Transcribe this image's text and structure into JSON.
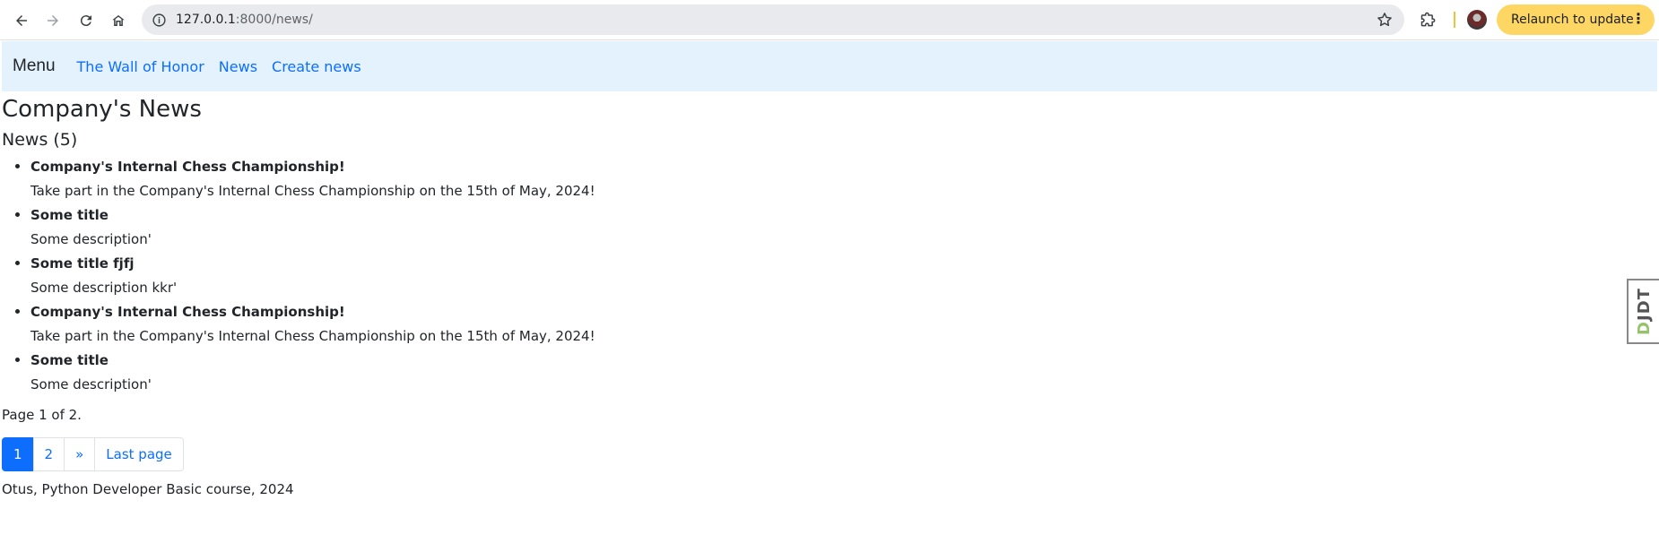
{
  "browser": {
    "url_host": "127.0.0.1",
    "url_rest": ":8000/news/",
    "relaunch_label": "Relaunch to update",
    "relaunch_menu": "⋮"
  },
  "navbar": {
    "brand": "Menu",
    "links": [
      "The Wall of Honor",
      "News",
      "Create news"
    ]
  },
  "page": {
    "title": "Company's News",
    "news_heading": "News (5)",
    "items": [
      {
        "title": "Company's Internal Chess Championship!",
        "description": "Take part in the Company's Internal Chess Championship on the 15th of May, 2024!"
      },
      {
        "title": "Some title",
        "description": "Some description'"
      },
      {
        "title": "Some title fjfj",
        "description": "Some description kkr'"
      },
      {
        "title": "Company's Internal Chess Championship!",
        "description": "Take part in the Company's Internal Chess Championship on the 15th of May, 2024!"
      },
      {
        "title": "Some title",
        "description": "Some description'"
      }
    ],
    "page_info": "Page 1 of 2.",
    "pagination": {
      "current": "1",
      "next_page": "2",
      "next": "»",
      "last": "Last page"
    },
    "footer": "Otus, Python Developer Basic course, 2024"
  },
  "debug_toolbar": {
    "prefix": "D",
    "rest": "JDT"
  },
  "colors": {
    "link": "#0d6efd",
    "navbar_bg": "#e3f2fd",
    "relaunch_bg": "#fdd663"
  }
}
